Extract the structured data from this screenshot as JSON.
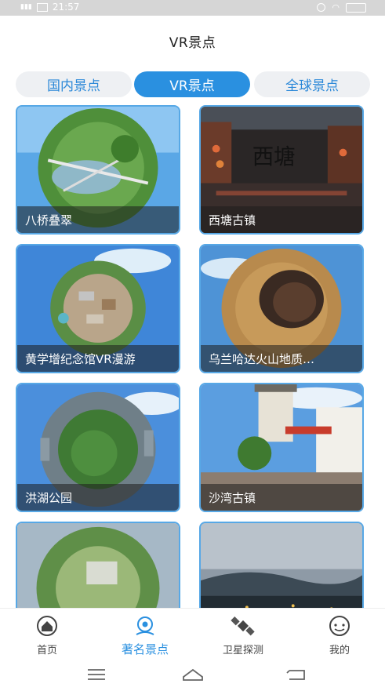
{
  "status": {
    "time": "21:57",
    "signal": "4G",
    "battery": ""
  },
  "page": {
    "title": "VR景点"
  },
  "tabs": [
    {
      "label": "国内景点"
    },
    {
      "label": "VR景点"
    },
    {
      "label": "全球景点"
    }
  ],
  "spots": [
    {
      "name": "八桥叠翠"
    },
    {
      "name": "西塘古镇",
      "sign": "西塘"
    },
    {
      "name": "黄学增纪念馆VR漫游"
    },
    {
      "name": "乌兰哈达火山地质…"
    },
    {
      "name": "洪湖公园"
    },
    {
      "name": "沙湾古镇"
    },
    {
      "name": ""
    },
    {
      "name": ""
    }
  ],
  "nav": [
    {
      "label": "首页",
      "icon": "home-icon"
    },
    {
      "label": "著名景点",
      "icon": "vr-camera-icon"
    },
    {
      "label": "卫星探测",
      "icon": "satellite-icon"
    },
    {
      "label": "我的",
      "icon": "profile-icon"
    }
  ],
  "colors": {
    "accent": "#2a90e0",
    "tab_bg": "#eef0f3"
  }
}
